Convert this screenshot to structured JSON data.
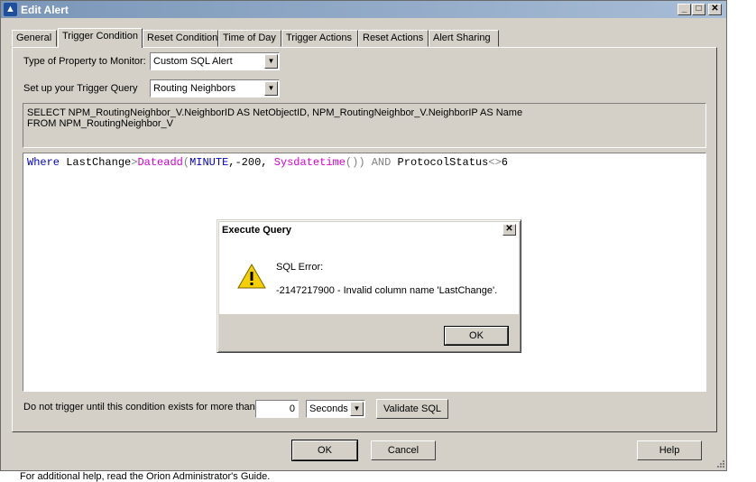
{
  "window": {
    "title": "Edit Alert"
  },
  "tabs": [
    {
      "label": "General"
    },
    {
      "label": "Trigger Condition"
    },
    {
      "label": "Reset Condition"
    },
    {
      "label": "Time of Day"
    },
    {
      "label": "Trigger Actions"
    },
    {
      "label": "Reset Actions"
    },
    {
      "label": "Alert Sharing"
    }
  ],
  "form": {
    "property_label": "Type of Property to Monitor:",
    "property_value": "Custom SQL Alert",
    "query_label": "Set up your Trigger Query",
    "query_value": "Routing Neighbors",
    "sql_prefix_line1": "SELECT NPM_RoutingNeighbor_V.NeighborID AS NetObjectID, NPM_RoutingNeighbor_V.NeighborIP AS Name",
    "sql_prefix_line2": "FROM NPM_RoutingNeighbor_V",
    "duration_label": "Do not trigger until this condition exists for more than",
    "duration_value": "0",
    "duration_unit": "Seconds",
    "validate_label": "Validate SQL"
  },
  "editor": {
    "t1": "Where",
    "t2": " LastChange",
    "t3": ">",
    "t4": "Dateadd",
    "t5": "(",
    "t6": "MINUTE",
    "t7": ",-200, ",
    "t8": "Sysdatetime",
    "t9": "())",
    "t10": " AND ",
    "t11": "ProtocolStatus",
    "t12": "<>",
    "t13": "6"
  },
  "buttons": {
    "ok": "OK",
    "cancel": "Cancel",
    "help": "Help"
  },
  "dialog": {
    "title": "Execute Query",
    "heading": "SQL Error:",
    "message": "-2147217900 - Invalid column name 'LastChange'.",
    "ok": "OK"
  },
  "status_text": "For additional help, read the Orion Administrator's Guide."
}
